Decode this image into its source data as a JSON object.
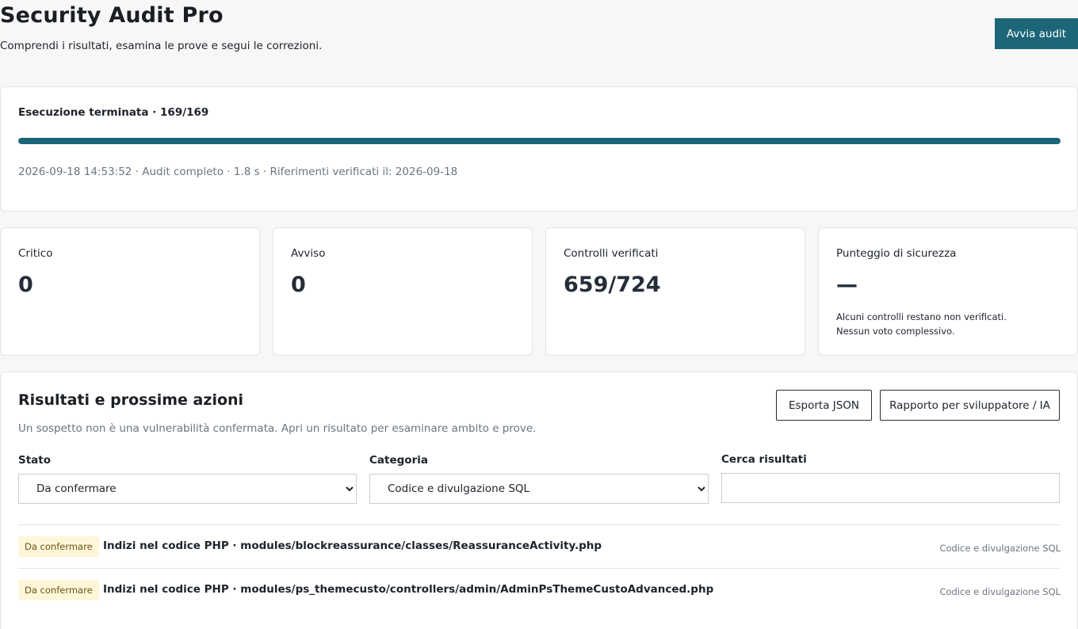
{
  "header": {
    "title": "Security Audit Pro",
    "subtitle": "Comprendi i risultati, esamina le prove e segui le correzioni.",
    "run_button": "Avvia audit"
  },
  "run": {
    "status": "Esecuzione terminata · 169/169",
    "progress_percent": 100,
    "meta": "2026-09-18 14:53:52 · Audit completo · 1.8 s · Riferimenti verificati il: 2026-09-18"
  },
  "stats": [
    {
      "label": "Critico",
      "value": "0",
      "note": []
    },
    {
      "label": "Avviso",
      "value": "0",
      "note": []
    },
    {
      "label": "Controlli verificati",
      "value": "659/724",
      "note": []
    },
    {
      "label": "Punteggio di sicurezza",
      "value": "—",
      "note": [
        "Alcuni controlli restano non verificati.",
        "Nessun voto complessivo."
      ]
    }
  ],
  "results": {
    "title": "Risultati e prossime azioni",
    "description": "Un sospetto non è una vulnerabilità confermata. Apri un risultato per esaminare ambito e prove.",
    "export_button": "Esporta JSON",
    "report_button": "Rapporto per sviluppatore / IA",
    "filters": {
      "status_label": "Stato",
      "status_value": "Da confermare",
      "category_label": "Categoria",
      "category_value": "Codice e divulgazione SQL",
      "search_label": "Cerca risultati",
      "search_value": ""
    },
    "items": [
      {
        "badge": "Da confermare",
        "title": "Indizi nel codice PHP · modules/blockreassurance/classes/ReassuranceActivity.php",
        "category": "Codice e divulgazione SQL"
      },
      {
        "badge": "Da confermare",
        "title": "Indizi nel codice PHP · modules/ps_themecusto/controllers/admin/AdminPsThemeCustoAdvanced.php",
        "category": "Codice e divulgazione SQL"
      }
    ]
  },
  "colors": {
    "accent": "#1c6678",
    "badge_bg": "#fff6da",
    "muted_text": "#6b7480"
  }
}
